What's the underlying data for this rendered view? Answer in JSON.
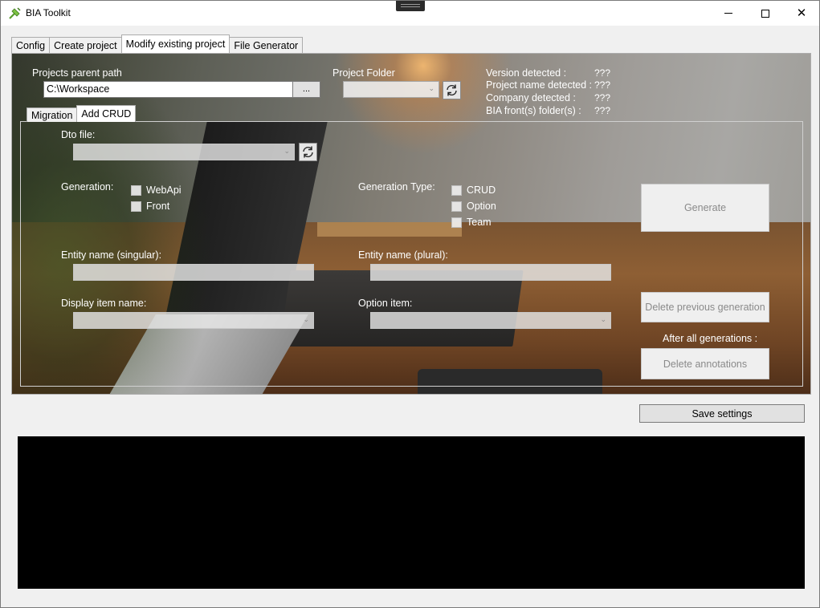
{
  "window": {
    "title": "BIA Toolkit"
  },
  "main_tabs": [
    {
      "label": "Config"
    },
    {
      "label": "Create project"
    },
    {
      "label": "Modify existing project"
    },
    {
      "label": "File Generator"
    }
  ],
  "top": {
    "projects_parent_path_label": "Projects parent path",
    "projects_parent_path_value": "C:\\Workspace",
    "browse_label": "...",
    "project_folder_label": "Project Folder",
    "detected": [
      {
        "label": "Version detected :",
        "value": "???"
      },
      {
        "label": "Project name detected :",
        "value": "???"
      },
      {
        "label": "Company detected :",
        "value": "???"
      },
      {
        "label": "BIA front(s) folder(s) :",
        "value": "???"
      }
    ]
  },
  "sub_tabs": [
    {
      "label": "Migration"
    },
    {
      "label": "Add CRUD"
    }
  ],
  "crud": {
    "dto_file_label": "Dto file:",
    "generation_label": "Generation:",
    "generation_options": [
      {
        "label": "WebApi"
      },
      {
        "label": "Front"
      }
    ],
    "generation_type_label": "Generation Type:",
    "generation_type_options": [
      {
        "label": "CRUD"
      },
      {
        "label": "Option"
      },
      {
        "label": "Team"
      }
    ],
    "generate_label": "Generate",
    "entity_singular_label": "Entity name (singular):",
    "entity_plural_label": "Entity name (plural):",
    "display_item_label": "Display item name:",
    "option_item_label": "Option item:",
    "delete_previous_label": "Delete previous generation",
    "after_all_label": "After all generations :",
    "delete_annotations_label": "Delete annotations"
  },
  "footer": {
    "save_settings_label": "Save settings"
  }
}
